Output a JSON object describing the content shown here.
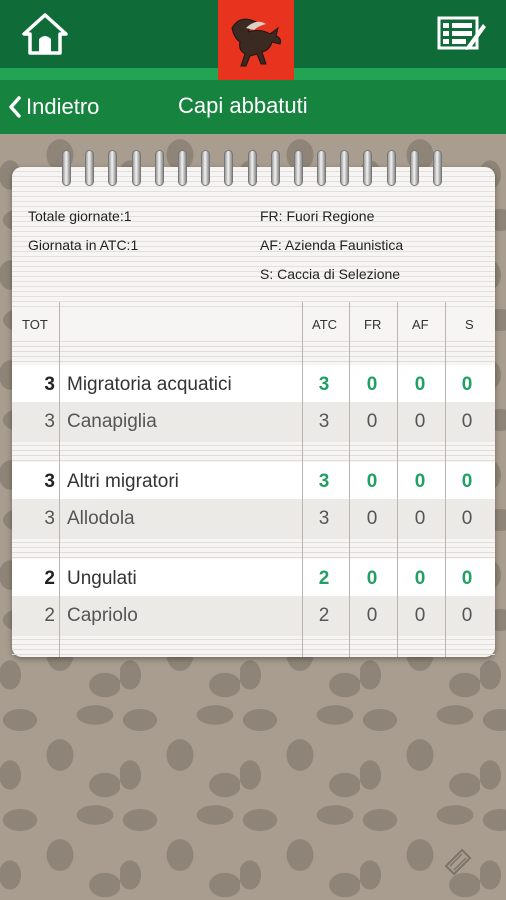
{
  "colors": {
    "header": "#0f6b37",
    "subheader": "#16833f",
    "accent_line": "#22a455",
    "logo_bg": "#e8341f",
    "value_green": "#22a064"
  },
  "nav": {
    "back_label": "Indietro",
    "title": "Capi abbatuti"
  },
  "info": {
    "totale_giornate": "Totale giornate:1",
    "giornata_atc": "Giornata in ATC:1",
    "legend_fr": "FR: Fuori Regione",
    "legend_af": "AF: Azienda Faunistica",
    "legend_s": "S: Caccia di Selezione"
  },
  "table": {
    "headers": {
      "tot": "TOT",
      "atc": "ATC",
      "fr": "FR",
      "af": "AF",
      "s": "S"
    },
    "groups": [
      {
        "category": {
          "tot": "3",
          "name": "Migratoria acquatici",
          "atc": "3",
          "fr": "0",
          "af": "0",
          "s": "0"
        },
        "item": {
          "tot": "3",
          "name": "Canapiglia",
          "atc": "3",
          "fr": "0",
          "af": "0",
          "s": "0"
        }
      },
      {
        "category": {
          "tot": "3",
          "name": "Altri migratori",
          "atc": "3",
          "fr": "0",
          "af": "0",
          "s": "0"
        },
        "item": {
          "tot": "3",
          "name": "Allodola",
          "atc": "3",
          "fr": "0",
          "af": "0",
          "s": "0"
        }
      },
      {
        "category": {
          "tot": "2",
          "name": "Ungulati",
          "atc": "2",
          "fr": "0",
          "af": "0",
          "s": "0"
        },
        "item": {
          "tot": "2",
          "name": "Capriolo",
          "atc": "2",
          "fr": "0",
          "af": "0",
          "s": "0"
        }
      }
    ]
  }
}
